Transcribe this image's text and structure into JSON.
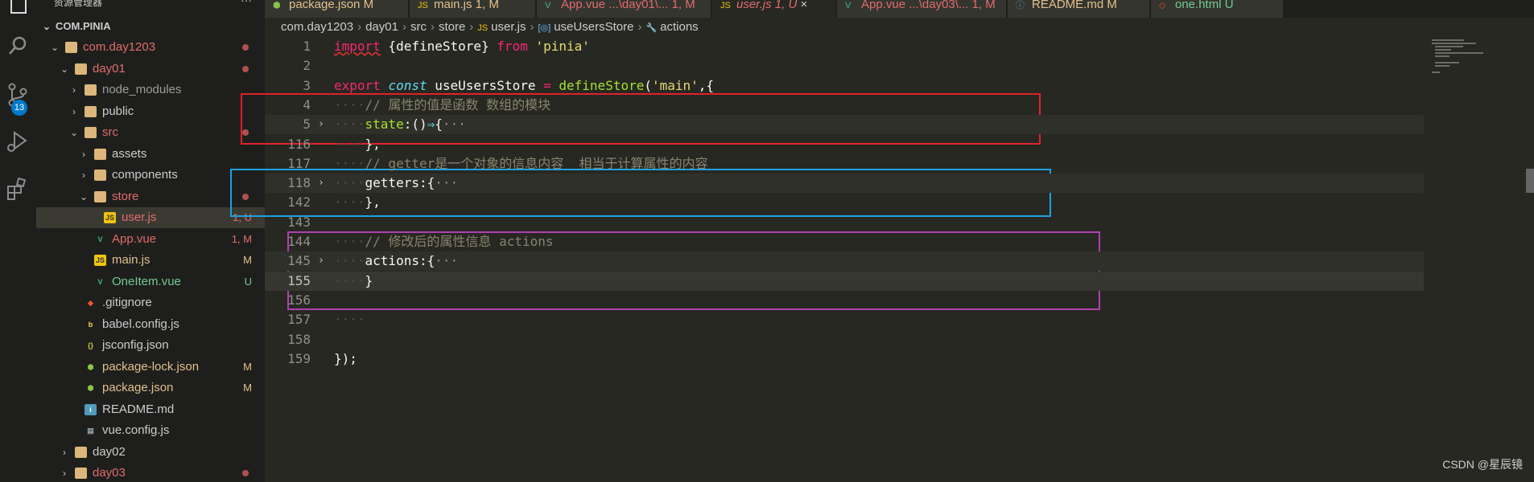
{
  "sidebar": {
    "header": "资源管理器",
    "root": "COM.PINIA",
    "items": [
      {
        "label": "com.day1203",
        "depth": 1,
        "type": "folder-open",
        "color": "red",
        "dot": true,
        "badge": ""
      },
      {
        "label": "day01",
        "depth": 2,
        "type": "folder-open",
        "color": "red",
        "dot": true,
        "badge": ""
      },
      {
        "label": "node_modules",
        "depth": 3,
        "type": "folder",
        "color": "grey",
        "dot": false,
        "badge": ""
      },
      {
        "label": "public",
        "depth": 3,
        "type": "folder",
        "color": "normal",
        "dot": false,
        "badge": ""
      },
      {
        "label": "src",
        "depth": 3,
        "type": "folder-open",
        "color": "red",
        "dot": true,
        "badge": ""
      },
      {
        "label": "assets",
        "depth": 4,
        "type": "folder",
        "color": "normal",
        "dot": false,
        "badge": ""
      },
      {
        "label": "components",
        "depth": 4,
        "type": "folder",
        "color": "normal",
        "dot": false,
        "badge": ""
      },
      {
        "label": "store",
        "depth": 4,
        "type": "folder-open",
        "color": "red",
        "dot": true,
        "badge": ""
      },
      {
        "label": "user.js",
        "depth": 5,
        "type": "js",
        "color": "red",
        "dot": false,
        "badge": "1, U",
        "selected": true
      },
      {
        "label": "App.vue",
        "depth": 4,
        "type": "vue",
        "color": "red",
        "dot": false,
        "badge": "1, M"
      },
      {
        "label": "main.js",
        "depth": 4,
        "type": "js",
        "color": "mod",
        "dot": false,
        "badge": "M"
      },
      {
        "label": "OneItem.vue",
        "depth": 4,
        "type": "vue",
        "color": "new",
        "dot": false,
        "badge": "U"
      },
      {
        "label": ".gitignore",
        "depth": 3,
        "type": "git",
        "color": "normal",
        "dot": false,
        "badge": ""
      },
      {
        "label": "babel.config.js",
        "depth": 3,
        "type": "babel",
        "color": "normal",
        "dot": false,
        "badge": ""
      },
      {
        "label": "jsconfig.json",
        "depth": 3,
        "type": "jsconfig",
        "color": "normal",
        "dot": false,
        "badge": ""
      },
      {
        "label": "package-lock.json",
        "depth": 3,
        "type": "npm",
        "color": "mod",
        "dot": false,
        "badge": "M"
      },
      {
        "label": "package.json",
        "depth": 3,
        "type": "npm",
        "color": "mod",
        "dot": false,
        "badge": "M"
      },
      {
        "label": "README.md",
        "depth": 3,
        "type": "info",
        "color": "normal",
        "dot": false,
        "badge": ""
      },
      {
        "label": "vue.config.js",
        "depth": 3,
        "type": "vueconfig",
        "color": "normal",
        "dot": false,
        "badge": ""
      },
      {
        "label": "day02",
        "depth": 2,
        "type": "folder",
        "color": "normal",
        "dot": false,
        "badge": ""
      },
      {
        "label": "day03",
        "depth": 2,
        "type": "folder",
        "color": "red",
        "dot": true,
        "badge": ""
      }
    ]
  },
  "activity": {
    "scm_badge": "13"
  },
  "tabs": [
    {
      "label": "package.json M",
      "icon": "npm"
    },
    {
      "label": "main.js 1, M",
      "icon": "js"
    },
    {
      "label": "App.vue ...\\day01\\... 1, M",
      "icon": "vue"
    },
    {
      "label": "user.js 1, U",
      "icon": "js",
      "active": true
    },
    {
      "label": "App.vue ...\\day03\\... 1, M",
      "icon": "vue"
    },
    {
      "label": "README.md M",
      "icon": "info"
    },
    {
      "label": "one.html U",
      "icon": "html"
    }
  ],
  "breadcrumb": {
    "parts": [
      "com.day1203",
      "day01",
      "src",
      "store",
      "user.js",
      "useUsersStore",
      "actions"
    ]
  },
  "code": {
    "lines": [
      {
        "n": "1",
        "tokens": [
          [
            "k-red",
            "import"
          ],
          [
            "",
            ""
          ],
          [
            "",
            " {defineStore} "
          ],
          [
            "k-red",
            "from"
          ],
          [
            "",
            " "
          ],
          [
            "k-str",
            "'pinia'"
          ]
        ]
      },
      {
        "n": "2",
        "tokens": []
      },
      {
        "n": "3",
        "tokens": [
          [
            "k-red",
            "export"
          ],
          [
            "",
            " "
          ],
          [
            "k-italic",
            "const"
          ],
          [
            "",
            " useUsersStore "
          ],
          [
            "k-red",
            "="
          ],
          [
            "",
            " "
          ],
          [
            "k-green",
            "defineStore"
          ],
          [
            "",
            "("
          ],
          [
            "k-str",
            "'main'"
          ],
          [
            "",
            ",{"
          ]
        ]
      },
      {
        "n": "4",
        "indent": true,
        "tokens": [
          [
            "k-com",
            "// 属性的值是函数 数组的模块"
          ]
        ]
      },
      {
        "n": "5",
        "indent": true,
        "fold": true,
        "hl": "fold",
        "tokens": [
          [
            "k-green",
            "state"
          ],
          [
            "",
            ":()"
          ],
          [
            "k-blue",
            "⇒"
          ],
          [
            "",
            "{"
          ],
          [
            "ell",
            "···"
          ]
        ]
      },
      {
        "n": "116",
        "indent": true,
        "tokens": [
          [
            "",
            "},"
          ]
        ]
      },
      {
        "n": "117",
        "indent": true,
        "tokens": [
          [
            "k-com",
            "// getter是一个对象的信息内容  相当于计算属性的内容"
          ]
        ]
      },
      {
        "n": "118",
        "indent": true,
        "fold": true,
        "hl": "fold",
        "tokens": [
          [
            "",
            "getters:{"
          ],
          [
            "ell",
            "···"
          ]
        ]
      },
      {
        "n": "142",
        "indent": true,
        "tokens": [
          [
            "",
            "},"
          ]
        ]
      },
      {
        "n": "143",
        "tokens": []
      },
      {
        "n": "144",
        "indent": true,
        "tokens": [
          [
            "k-com",
            "// 修改后的属性信息 actions"
          ]
        ]
      },
      {
        "n": "145",
        "indent": true,
        "fold": true,
        "hl": "fold",
        "tokens": [
          [
            "",
            "actions:{"
          ],
          [
            "ell",
            "···"
          ]
        ]
      },
      {
        "n": "155",
        "indent": true,
        "active": true,
        "hl": "cur",
        "tokens": [
          [
            "",
            "}"
          ]
        ]
      },
      {
        "n": "156",
        "tokens": []
      },
      {
        "n": "157",
        "indent": true,
        "tokens": []
      },
      {
        "n": "158",
        "tokens": []
      },
      {
        "n": "159",
        "tokens": [
          [
            "",
            "});"
          ]
        ]
      }
    ]
  },
  "annotations": [
    {
      "name": "state-highlight-box",
      "color": "#e0212b"
    },
    {
      "name": "getters-highlight-box",
      "color": "#1fa0e0"
    },
    {
      "name": "actions-highlight-box",
      "color": "#b040b0"
    }
  ],
  "watermark": "CSDN @星辰镜",
  "colors": {
    "accent": "#007acc",
    "editor_bg": "#272822",
    "sidebar_bg": "#1e1f1c"
  }
}
